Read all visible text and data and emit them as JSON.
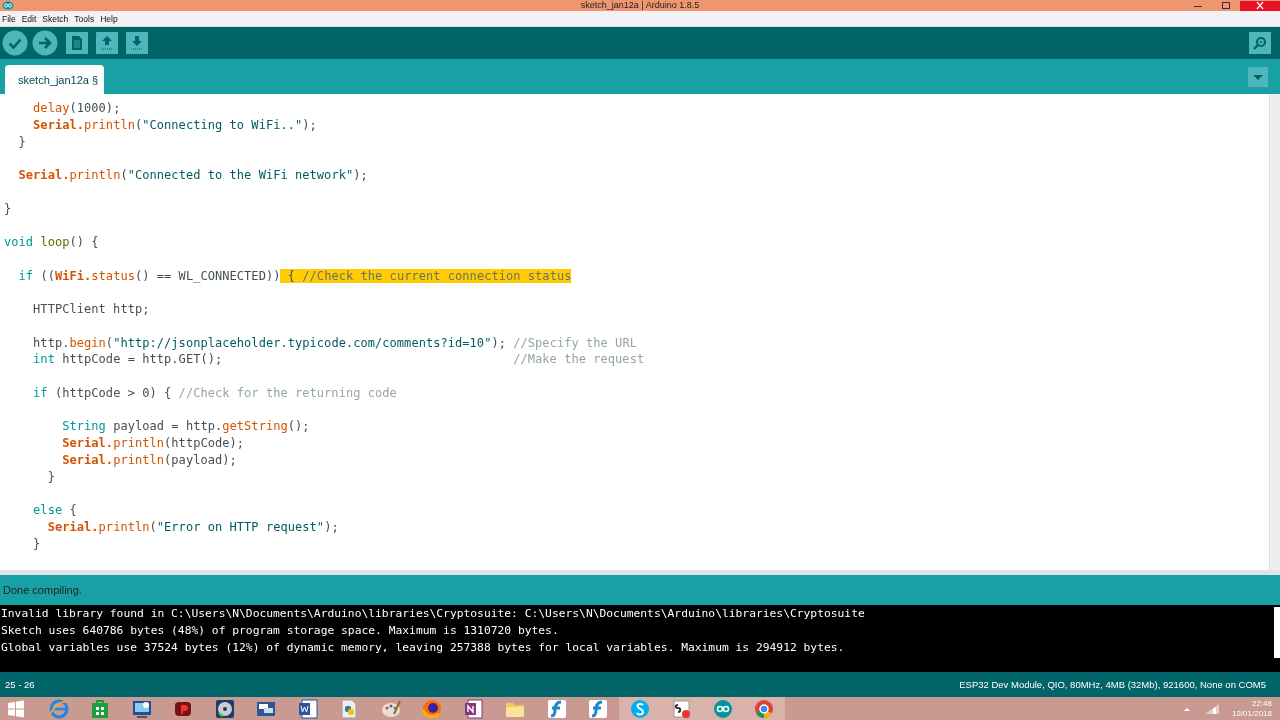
{
  "window": {
    "title": "sketch_jan12a | Arduino 1.8.5"
  },
  "menu": [
    "File",
    "Edit",
    "Sketch",
    "Tools",
    "Help"
  ],
  "tabs": [
    {
      "label": "sketch_jan12a §",
      "selected": true
    }
  ],
  "editor": {
    "lines": [
      {
        "kind": "code",
        "tokens": [
          {
            "text": "    delay",
            "kind": "function",
            "selected": false
          },
          {
            "text": "(1000);",
            "kind": "plain",
            "selected": false
          }
        ]
      },
      {
        "kind": "code",
        "tokens": [
          {
            "text": "    Serial.",
            "kind": "class",
            "selected": false
          },
          {
            "text": "println",
            "kind": "function",
            "selected": false
          },
          {
            "text": "(",
            "kind": "plain",
            "selected": false
          },
          {
            "text": "\"Connecting to WiFi..\"",
            "kind": "string",
            "selected": false
          },
          {
            "text": ");",
            "kind": "plain",
            "selected": false
          }
        ]
      },
      {
        "kind": "code",
        "tokens": [
          {
            "text": "  }",
            "kind": "plain",
            "selected": false
          }
        ]
      },
      {
        "kind": "blank"
      },
      {
        "kind": "code",
        "tokens": [
          {
            "text": "  Serial.",
            "kind": "class",
            "selected": false
          },
          {
            "text": "println",
            "kind": "function",
            "selected": false
          },
          {
            "text": "(",
            "kind": "plain",
            "selected": false
          },
          {
            "text": "\"Connected to the WiFi network\"",
            "kind": "string",
            "selected": false
          },
          {
            "text": ");",
            "kind": "plain",
            "selected": false
          }
        ]
      },
      {
        "kind": "blank"
      },
      {
        "kind": "code",
        "tokens": [
          {
            "text": "}",
            "kind": "plain",
            "selected": false
          }
        ]
      },
      {
        "kind": "blank"
      },
      {
        "kind": "code",
        "tokens": [
          {
            "text": "void",
            "kind": "keyword",
            "selected": false
          },
          {
            "text": " loop",
            "kind": "entry",
            "selected": false
          },
          {
            "text": "() {",
            "kind": "plain",
            "selected": false
          }
        ]
      },
      {
        "kind": "blank"
      },
      {
        "kind": "code",
        "tokens": [
          {
            "text": "  if",
            "kind": "keyword",
            "selected": false
          },
          {
            "text": " ((",
            "kind": "plain",
            "selected": false
          },
          {
            "text": "WiFi.",
            "kind": "class",
            "selected": false
          },
          {
            "text": "status",
            "kind": "function",
            "selected": false
          },
          {
            "text": "() == WL_CONNECTED))",
            "kind": "plain",
            "selected": false
          },
          {
            "text": " {",
            "kind": "plain",
            "selected": true
          },
          {
            "text": " //Check the current connection status",
            "kind": "comment",
            "selected": true
          }
        ]
      },
      {
        "kind": "blank"
      },
      {
        "kind": "code",
        "tokens": [
          {
            "text": "    HTTPClient http;",
            "kind": "plain",
            "selected": false
          }
        ]
      },
      {
        "kind": "blank"
      },
      {
        "kind": "code",
        "tokens": [
          {
            "text": "    http.",
            "kind": "plain",
            "selected": false
          },
          {
            "text": "begin",
            "kind": "function",
            "selected": false
          },
          {
            "text": "(",
            "kind": "plain",
            "selected": false
          },
          {
            "text": "\"http://jsonplaceholder.typicode.com/comments?id=10\"",
            "kind": "string",
            "selected": false
          },
          {
            "text": ");",
            "kind": "plain",
            "selected": false
          },
          {
            "text": " //Specify the URL",
            "kind": "comment",
            "selected": false
          }
        ]
      },
      {
        "kind": "code",
        "tokens": [
          {
            "text": "    int",
            "kind": "keyword",
            "selected": false
          },
          {
            "text": " httpCode = http.GET();",
            "kind": "plain",
            "selected": false
          },
          {
            "text": "                                        //Make the request",
            "kind": "comment",
            "selected": false
          }
        ]
      },
      {
        "kind": "blank"
      },
      {
        "kind": "code",
        "tokens": [
          {
            "text": "    if",
            "kind": "keyword",
            "selected": false
          },
          {
            "text": " (httpCode > 0) {",
            "kind": "plain",
            "selected": false
          },
          {
            "text": " //Check for the returning code",
            "kind": "comment",
            "selected": false
          }
        ]
      },
      {
        "kind": "blank"
      },
      {
        "kind": "code",
        "tokens": [
          {
            "text": "        String",
            "kind": "keyword",
            "selected": false
          },
          {
            "text": " payload = http.",
            "kind": "plain",
            "selected": false
          },
          {
            "text": "getString",
            "kind": "function",
            "selected": false
          },
          {
            "text": "();",
            "kind": "plain",
            "selected": false
          }
        ]
      },
      {
        "kind": "code",
        "tokens": [
          {
            "text": "        Serial.",
            "kind": "class",
            "selected": false
          },
          {
            "text": "println",
            "kind": "function",
            "selected": false
          },
          {
            "text": "(httpCode);",
            "kind": "plain",
            "selected": false
          }
        ]
      },
      {
        "kind": "code",
        "tokens": [
          {
            "text": "        Serial.",
            "kind": "class",
            "selected": false
          },
          {
            "text": "println",
            "kind": "function",
            "selected": false
          },
          {
            "text": "(payload);",
            "kind": "plain",
            "selected": false
          }
        ]
      },
      {
        "kind": "code",
        "tokens": [
          {
            "text": "      }",
            "kind": "plain",
            "selected": false
          }
        ]
      },
      {
        "kind": "blank"
      },
      {
        "kind": "code",
        "tokens": [
          {
            "text": "    else",
            "kind": "keyword",
            "selected": false
          },
          {
            "text": " {",
            "kind": "plain",
            "selected": false
          }
        ]
      },
      {
        "kind": "code",
        "tokens": [
          {
            "text": "      Serial.",
            "kind": "class",
            "selected": false
          },
          {
            "text": "println",
            "kind": "function",
            "selected": false
          },
          {
            "text": "(",
            "kind": "plain",
            "selected": false
          },
          {
            "text": "\"Error on HTTP request\"",
            "kind": "string",
            "selected": false
          },
          {
            "text": ");",
            "kind": "plain",
            "selected": false
          }
        ]
      },
      {
        "kind": "code",
        "tokens": [
          {
            "text": "    }",
            "kind": "plain",
            "selected": false
          }
        ]
      }
    ]
  },
  "status_message": "Done compiling.",
  "console": [
    "Invalid library found in C:\\Users\\N\\Documents\\Arduino\\libraries\\Cryptosuite: C:\\Users\\N\\Documents\\Arduino\\libraries\\Cryptosuite",
    "Sketch uses 640786 bytes (48%) of program storage space. Maximum is 1310720 bytes.",
    "Global variables use 37524 bytes (12%) of dynamic memory, leaving 257388 bytes for local variables. Maximum is 294912 bytes."
  ],
  "status_bar": {
    "position": "25 - 26",
    "board": "ESP32 Dev Module, QIO, 80MHz, 4MB (32Mb), 921600, None on COM5"
  },
  "taskbar": {
    "items": [
      {
        "open": false
      },
      {
        "open": false
      },
      {
        "open": false
      },
      {
        "open": false
      },
      {
        "open": false
      },
      {
        "open": false
      },
      {
        "open": false
      },
      {
        "open": false
      },
      {
        "open": false
      },
      {
        "open": false
      },
      {
        "open": false
      },
      {
        "open": false
      },
      {
        "open": false
      },
      {
        "open": false
      },
      {
        "open": true
      },
      {
        "open": true
      },
      {
        "open": true
      },
      {
        "open": true
      }
    ],
    "time": "22:48",
    "date": "12/01/2018"
  }
}
